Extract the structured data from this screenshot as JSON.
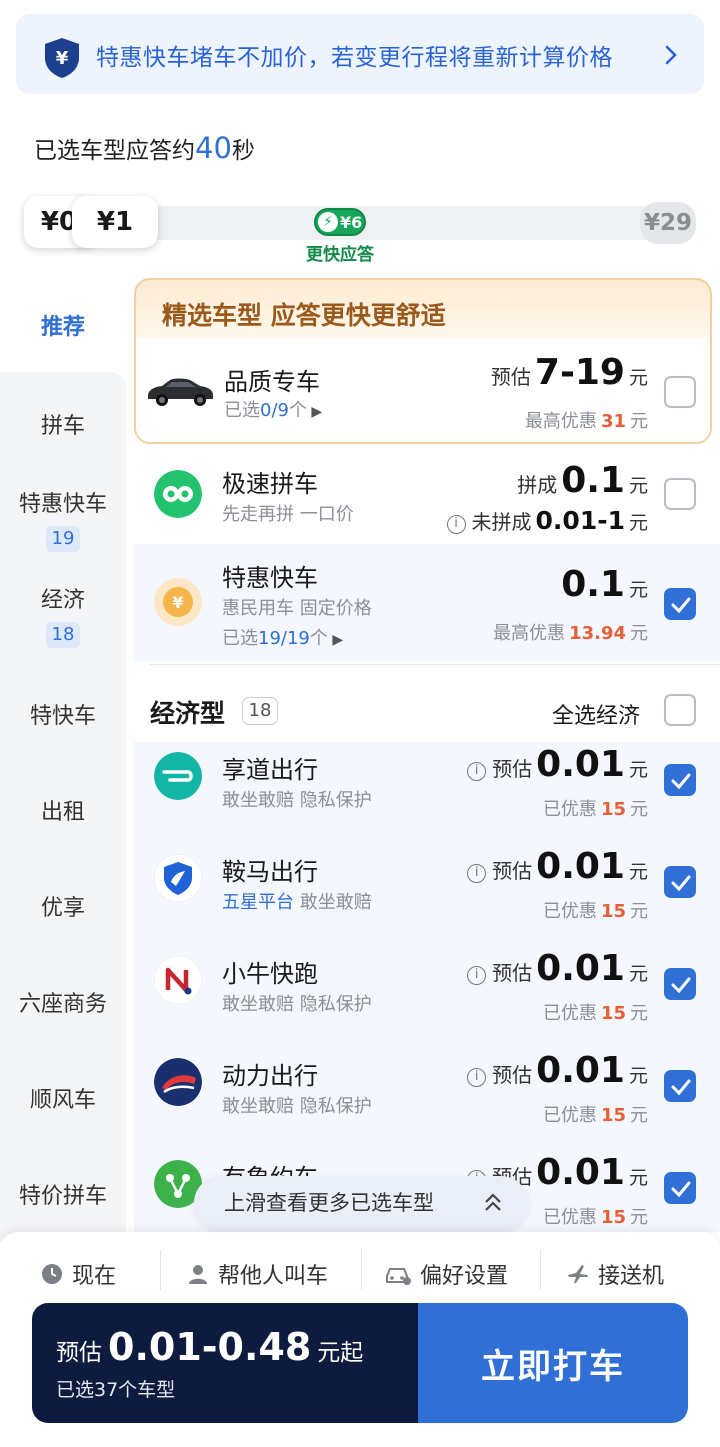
{
  "banner": {
    "icon_symbol": "¥",
    "text": "特惠快车堵车不加价，若变更行程将重新计算价格"
  },
  "response": {
    "prefix": "已选车型应答约",
    "seconds": "40",
    "suffix": "秒"
  },
  "slider": {
    "thumb_back": "¥0",
    "thumb_front": "¥1",
    "max": "¥29",
    "mark_value": "¥6",
    "mark_label": "更快应答"
  },
  "sidebar": {
    "active": "推荐",
    "items": [
      {
        "label": "拼车",
        "badge": ""
      },
      {
        "label": "特惠快车",
        "badge": "19"
      },
      {
        "label": "经济",
        "badge": "18"
      },
      {
        "label": "特快车",
        "badge": ""
      },
      {
        "label": "出租",
        "badge": ""
      },
      {
        "label": "优享",
        "badge": ""
      },
      {
        "label": "六座商务",
        "badge": ""
      },
      {
        "label": "顺风车",
        "badge": ""
      },
      {
        "label": "特价拼车",
        "badge": ""
      }
    ]
  },
  "featured": {
    "title": "精选车型 应答更快更舒适",
    "name": "品质专车",
    "sub_prefix": "已选",
    "sub_count": "0/9",
    "sub_suffix": "个",
    "price_prefix": "预估",
    "price": "7-19",
    "unit": "元",
    "disc_prefix": "最高优惠",
    "disc": "31",
    "disc_unit": "元",
    "checked": false
  },
  "pool": {
    "name": "极速拼车",
    "sub": "先走再拼 一口价",
    "price_prefix": "拼成",
    "price": "0.1",
    "unit": "元",
    "alt_prefix": "未拼成",
    "alt_price": "0.01-1",
    "alt_unit": "元",
    "checked": false
  },
  "special": {
    "name": "特惠快车",
    "sub1": "惠民用车 固定价格",
    "sub2_prefix": "已选",
    "sub2_count": "19/19",
    "sub2_suffix": "个",
    "price": "0.1",
    "unit": "元",
    "disc_prefix": "最高优惠",
    "disc": "13.94",
    "disc_unit": "元",
    "checked": true
  },
  "economy": {
    "title": "经济型",
    "count": "18",
    "select_all": "全选经济",
    "select_all_checked": false,
    "items": [
      {
        "name": "享道出行",
        "tag": "",
        "sub": "敢坐敢赔 隐私保护",
        "price_prefix": "预估",
        "price": "0.01",
        "unit": "元",
        "disc_prefix": "已优惠",
        "disc": "15",
        "disc_unit": "元",
        "checked": true
      },
      {
        "name": "鞍马出行",
        "tag": "五星平台",
        "sub": "敢坐敢赔",
        "price_prefix": "预估",
        "price": "0.01",
        "unit": "元",
        "disc_prefix": "已优惠",
        "disc": "15",
        "disc_unit": "元",
        "checked": true
      },
      {
        "name": "小牛快跑",
        "tag": "",
        "sub": "敢坐敢赔 隐私保护",
        "price_prefix": "预估",
        "price": "0.01",
        "unit": "元",
        "disc_prefix": "已优惠",
        "disc": "15",
        "disc_unit": "元",
        "checked": true
      },
      {
        "name": "动力出行",
        "tag": "",
        "sub": "敢坐敢赔 隐私保护",
        "price_prefix": "预估",
        "price": "0.01",
        "unit": "元",
        "disc_prefix": "已优惠",
        "disc": "15",
        "disc_unit": "元",
        "checked": true
      },
      {
        "name": "有象约车",
        "tag": "",
        "sub": "",
        "price_prefix": "预估",
        "price": "0.01",
        "unit": "元",
        "disc_prefix": "已优惠",
        "disc": "15",
        "disc_unit": "元",
        "checked": true
      }
    ]
  },
  "scroll_hint": "上滑查看更多已选车型",
  "toolbar": {
    "now": "现在",
    "for_other": "帮他人叫车",
    "preference": "偏好设置",
    "airport": "接送机"
  },
  "cta": {
    "est_prefix": "预估",
    "est_range": "0.01-0.48",
    "est_suffix": "元起",
    "selected": "已选37个车型",
    "button": "立即打车"
  },
  "colors": {
    "accent": "#2f6fd6",
    "dark": "#0d1b3e",
    "discount": "#e5603a",
    "green": "#17a55a"
  }
}
